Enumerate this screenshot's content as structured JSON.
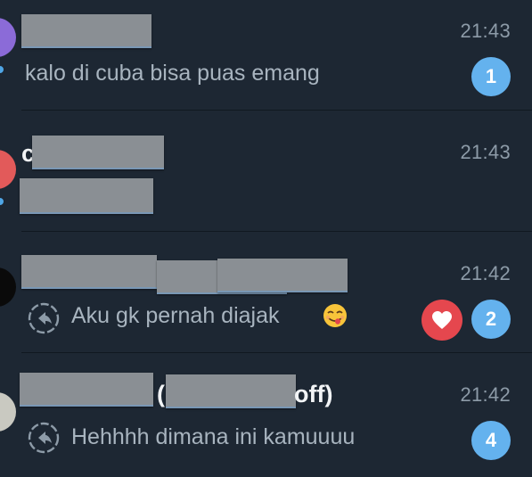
{
  "chats": [
    {
      "time": "21:43",
      "preview": "kalo di cuba bisa puas emang",
      "unread": "1",
      "avatar_color": "#8b6bd8"
    },
    {
      "name_fragment": "c",
      "time": "21:43",
      "unread": null,
      "avatar_color": "#e25a5a"
    },
    {
      "time": "21:42",
      "preview": "Aku gk pernah diajak",
      "emoji": "face-savoring-food-emoji",
      "reaction": "heart-icon",
      "unread": "2",
      "avatar_color": "#0a0a0a"
    },
    {
      "name_fragment_1": "(",
      "name_fragment_2": "off)",
      "time": "21:42",
      "preview": "Hehhhh dimana ini kamuuuu",
      "unread": "4",
      "avatar_color": "#c9c9c1"
    }
  ],
  "colors": {
    "background": "#1d2733",
    "badge": "#64b2ee",
    "reaction_badge": "#e5474e",
    "time_text": "#8d9ba8",
    "preview_text": "#a8b4bf"
  }
}
